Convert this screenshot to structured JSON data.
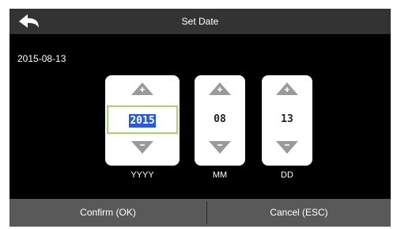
{
  "header": {
    "title": "Set Date",
    "back_icon": "back-arrow-icon"
  },
  "current_date": "2015-08-13",
  "spinners": [
    {
      "value": "2015",
      "label": "YYYY",
      "selected": true
    },
    {
      "value": "08",
      "label": "MM",
      "selected": false
    },
    {
      "value": "13",
      "label": "DD",
      "selected": false
    }
  ],
  "footer": {
    "confirm_label": "Confirm (OK)",
    "cancel_label": "Cancel (ESC)"
  },
  "colors": {
    "title_bar": "#333333",
    "screen": "#000000",
    "footer": "#595959",
    "focus_border": "#a8d470",
    "selection": "#2a5bd6",
    "arrow": "#9a9a9a"
  }
}
